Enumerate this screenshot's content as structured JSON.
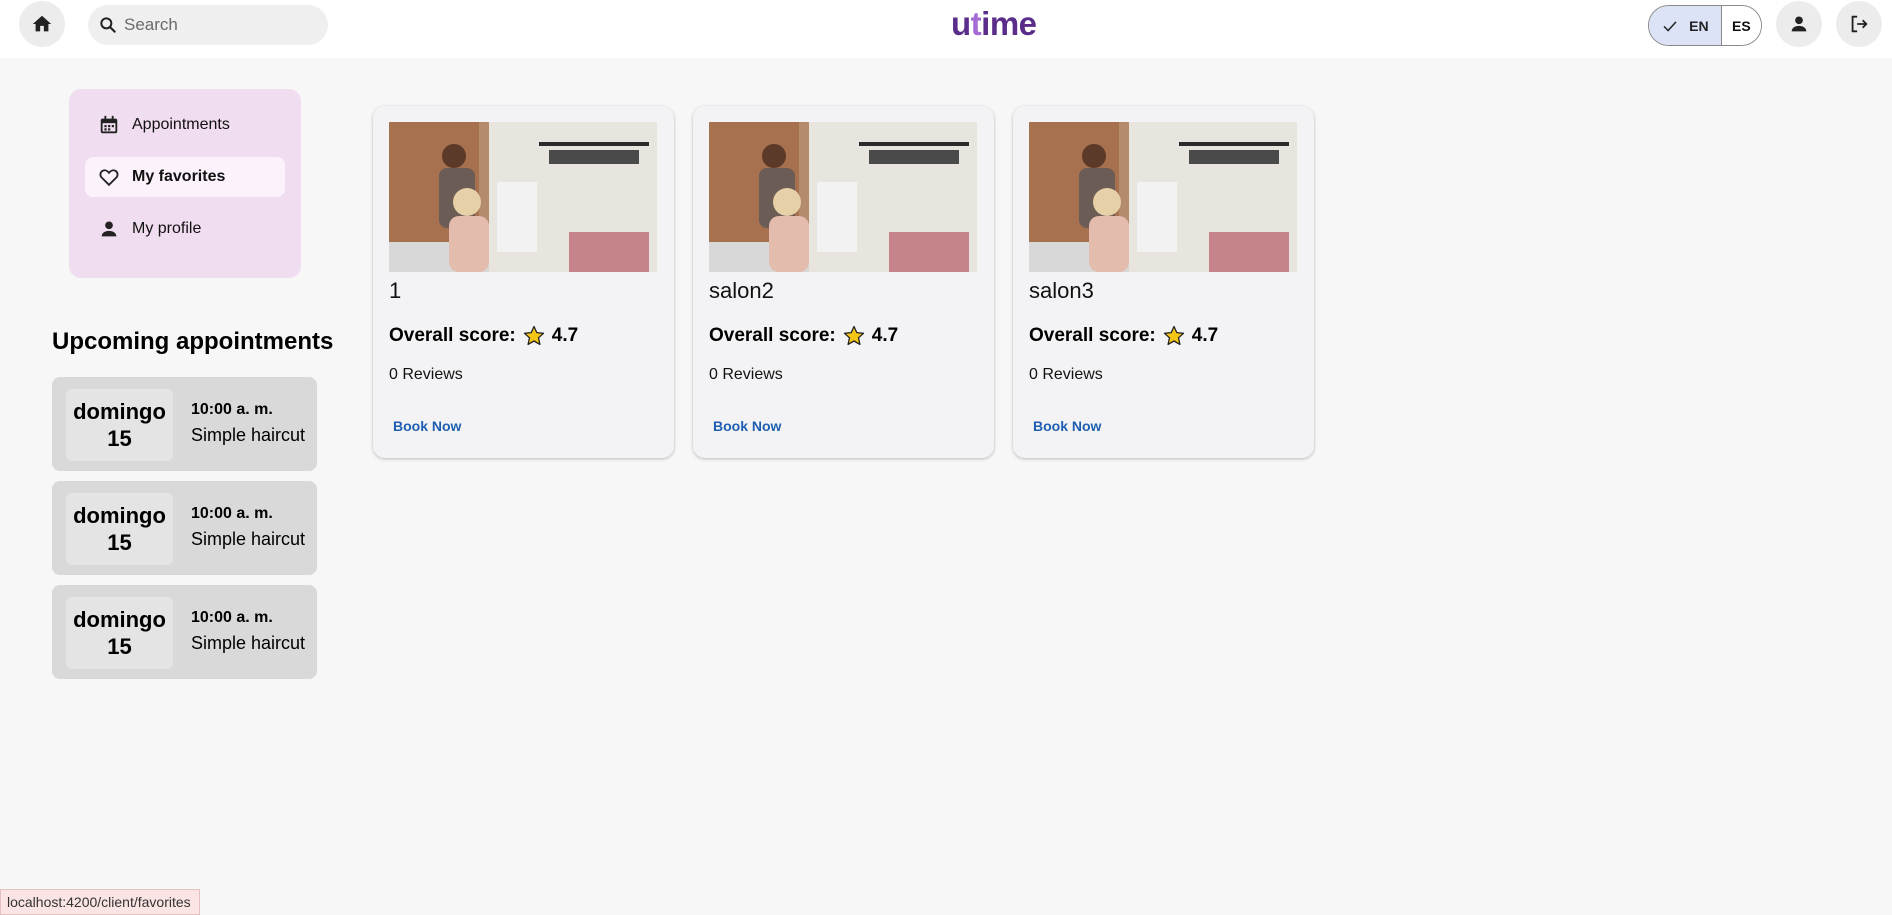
{
  "header": {
    "search_placeholder": "Search",
    "logo_text_pre": "u",
    "logo_text_t": "t",
    "logo_text_post": "ime",
    "lang_en": "EN",
    "lang_es": "ES",
    "lang_selected": "EN"
  },
  "sidebar": {
    "items": [
      {
        "label": "Appointments",
        "icon": "calendar-icon",
        "active": false
      },
      {
        "label": "My favorites",
        "icon": "heart-icon",
        "active": true
      },
      {
        "label": "My profile",
        "icon": "person-icon",
        "active": false
      }
    ]
  },
  "upcoming": {
    "title": "Upcoming appointments",
    "items": [
      {
        "day": "domingo",
        "date": "15",
        "time": "10:00 a. m.",
        "service": "Simple haircut"
      },
      {
        "day": "domingo",
        "date": "15",
        "time": "10:00 a. m.",
        "service": "Simple haircut"
      },
      {
        "day": "domingo",
        "date": "15",
        "time": "10:00 a. m.",
        "service": "Simple haircut"
      }
    ]
  },
  "salons": [
    {
      "name": "1",
      "score_label": "Overall score:",
      "score": "4.7",
      "reviews": "0 Reviews",
      "book_label": "Book Now"
    },
    {
      "name": "salon2",
      "score_label": "Overall score:",
      "score": "4.7",
      "reviews": "0 Reviews",
      "book_label": "Book Now"
    },
    {
      "name": "salon3",
      "score_label": "Overall score:",
      "score": "4.7",
      "reviews": "0 Reviews",
      "book_label": "Book Now"
    }
  ],
  "status_bar": {
    "url": "localhost:4200/client/favorites"
  },
  "colors": {
    "brand": "#5b2d8a",
    "menu_bg": "#f0ddef",
    "link": "#1e5fb0",
    "star": "#f5c518"
  }
}
